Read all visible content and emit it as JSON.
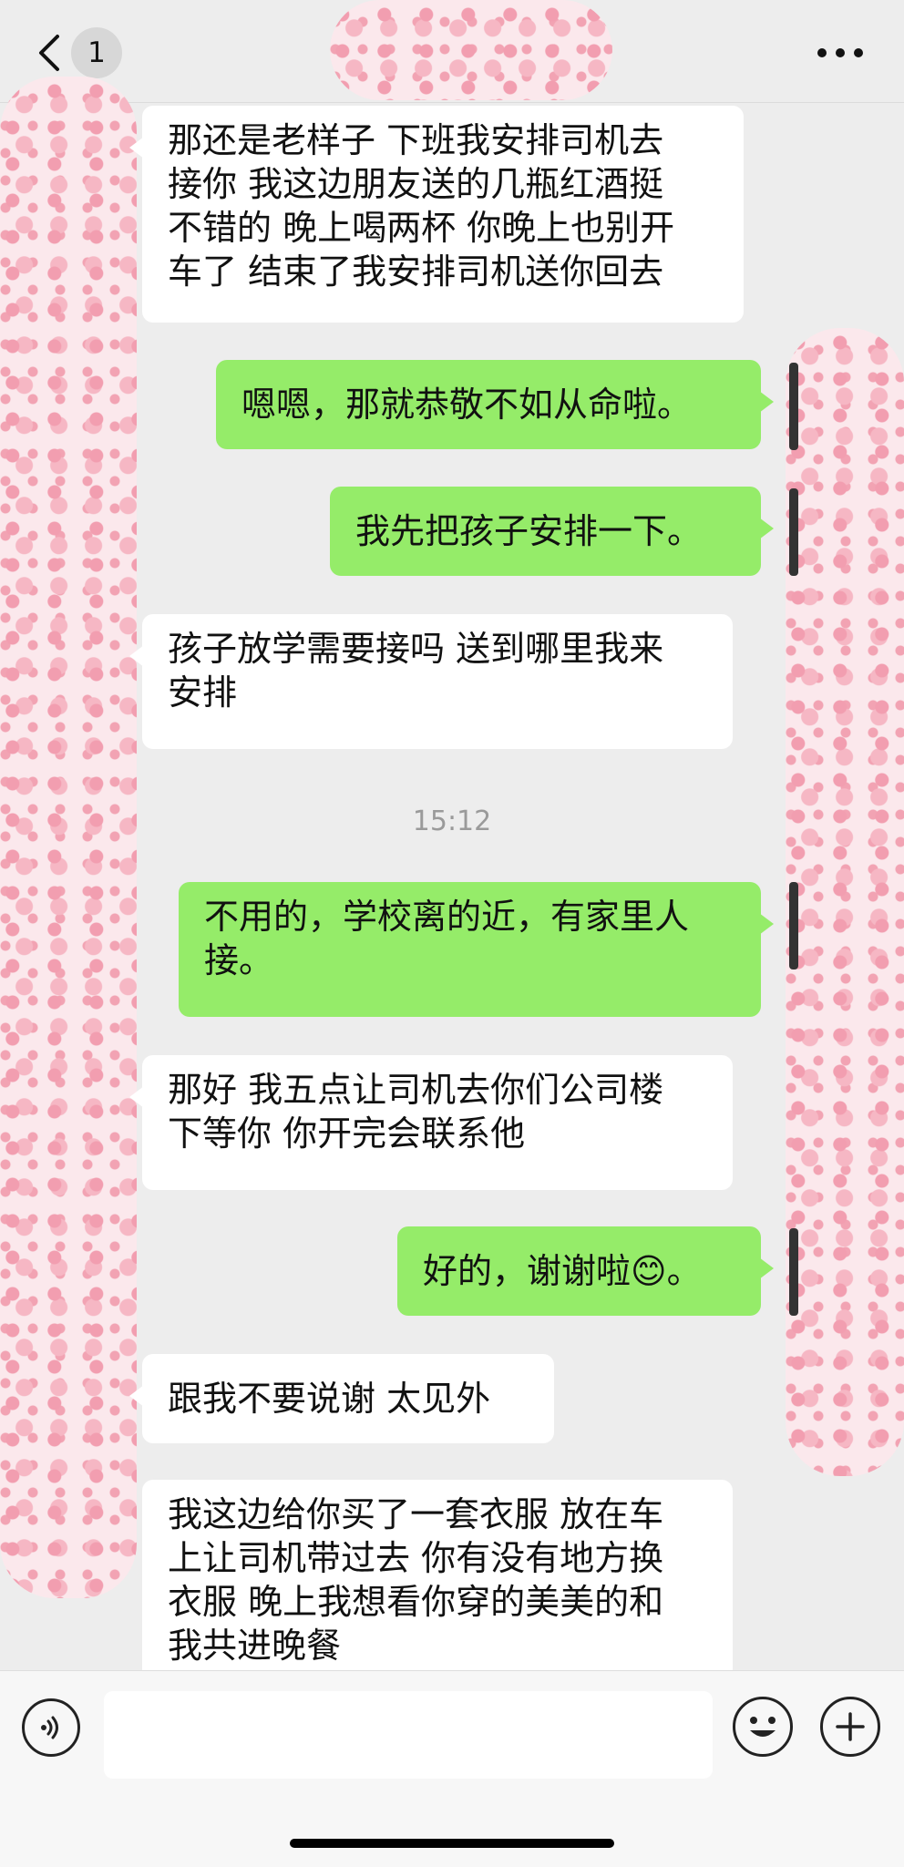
{
  "header": {
    "back_icon": "chevron-left-icon",
    "unread_badge": "1",
    "more_icon": "ellipsis-icon"
  },
  "messages": [
    {
      "side": "left",
      "text": "那还是老样子 下班我安排司机去\n接你 我这边朋友送的几瓶红酒挺\n不错的 晚上喝两杯 你晚上也别开\n车了 结束了我安排司机送你回去"
    },
    {
      "side": "right",
      "text": "嗯嗯，那就恭敬不如从命啦。"
    },
    {
      "side": "right",
      "text": "我先把孩子安排一下。"
    },
    {
      "side": "left",
      "text": "孩子放学需要接吗 送到哪里我来\n安排"
    },
    {
      "side": "time",
      "text": "15:12"
    },
    {
      "side": "right",
      "text": "不用的，学校离的近，有家里人\n接。"
    },
    {
      "side": "left",
      "text": "那好 我五点让司机去你们公司楼\n下等你 你开完会联系他"
    },
    {
      "side": "right",
      "text": "好的，谢谢啦😊。"
    },
    {
      "side": "left",
      "text": "跟我不要说谢 太见外"
    },
    {
      "side": "left",
      "text": "我这边给你买了一套衣服 放在车\n上让司机带过去 你有没有地方换\n衣服 晚上我想看你穿的美美的和\n我共进晚餐"
    }
  ],
  "footer": {
    "voice_icon": "voice-icon",
    "input_value": "",
    "emoji_icon": "emoji-icon",
    "plus_icon": "plus-icon"
  }
}
